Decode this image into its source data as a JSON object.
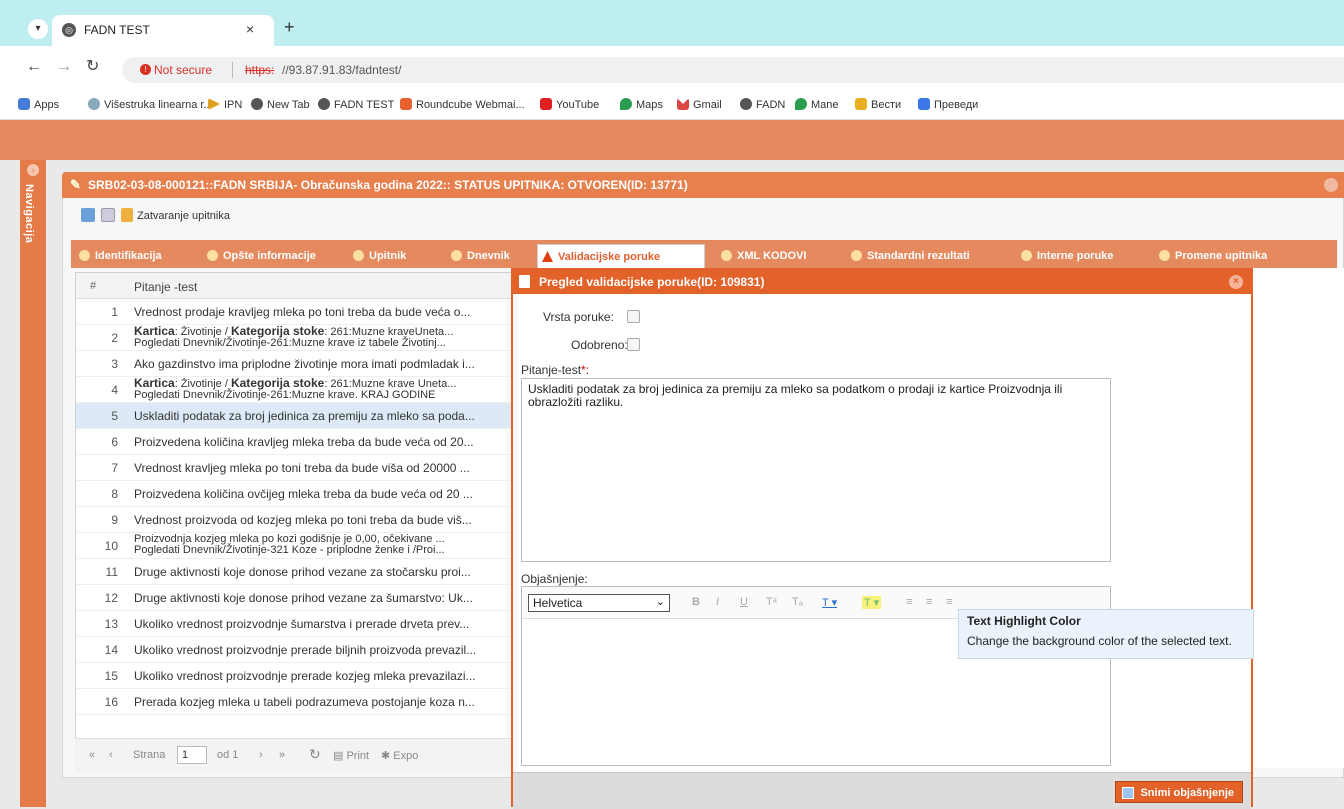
{
  "browser": {
    "tab_title": "FADN TEST",
    "tab_close": "×",
    "new_tab": "+",
    "not_secure": "Not secure",
    "url_scheme": "https:",
    "url_rest": "//93.87.91.83/fadntest/",
    "bookmarks": [
      "Apps",
      "Višestruka linearna r...",
      "IPN",
      "New Tab",
      "FADN TEST",
      "Roundcube Webmai...",
      "YouTube",
      "Maps",
      "Gmail",
      "FADN",
      "Mane",
      "Вести",
      "Преведи"
    ]
  },
  "nav": {
    "label": "Navigacija"
  },
  "window": {
    "title": "SRB02-03-08-000121::FADN SRBIJA- Obračunska godina 2022:: STATUS UPITNIKA: OTVOREN(ID: 13771)",
    "toolbar_label": "Zatvaranje upitnika"
  },
  "tabs": [
    "Identifikacija",
    "Opšte informacije",
    "Upitnik",
    "Dnevnik",
    "Validacijske poruke",
    "XML KODOVI",
    "Standardni rezultati",
    "Interne poruke",
    "Promene upitnika"
  ],
  "grid": {
    "num_header": "#",
    "col_header": "Pitanje -test",
    "rows": [
      {
        "n": "1",
        "text": "Vrednost prodaje kravljeg mleka po toni treba da bude veća o..."
      },
      {
        "n": "2",
        "b1": "Kartica",
        "t1": ": Životinje / ",
        "b2": "Kategorija stoke",
        "t2": ": 261:Muzne kraveUneta...",
        "l2": "Pogledati Dnevnik/Životinje-261:Muzne krave iz tabele Životinj..."
      },
      {
        "n": "3",
        "text": "Ako gazdinstvo ima priplodne životinje mora imati podmladak i..."
      },
      {
        "n": "4",
        "b1": "Kartica",
        "t1": ": Životinje / ",
        "b2": "Kategorija stoke",
        "t2": ": 261:Muzne krave Uneta...",
        "l2": "Pogledati Dnevnik/Životinje-261:Muzne krave. KRAJ GODINE"
      },
      {
        "n": "5",
        "text": "Uskladiti podatak za broj jedinica za premiju za mleko sa poda..."
      },
      {
        "n": "6",
        "text": "Proizvedena količina kravljeg mleka treba da bude veća od 20..."
      },
      {
        "n": "7",
        "text": "Vrednost kravljeg mleka po toni treba da bude viša od 20000 ..."
      },
      {
        "n": "8",
        "text": "Proizvedena količina ovčijeg mleka treba da bude veća od 20 ..."
      },
      {
        "n": "9",
        "text": "Vrednost proizvoda od kozjeg mleka po toni treba da bude viš..."
      },
      {
        "n": "10",
        "text": "Proizvodnja kozjeg mleka po kozi godišnje je 0,00, očekivane ...",
        "l2": "Pogledati Dnevnik/Životinje-321 Koze - priplodne ženke i /Proi..."
      },
      {
        "n": "11",
        "text": "Druge aktivnosti koje donose prihod vezane za stočarsku proi..."
      },
      {
        "n": "12",
        "text": "Druge aktivnosti koje donose prihod vezane za šumarstvo: Uk..."
      },
      {
        "n": "13",
        "text": "Ukoliko vrednost proizvodnje šumarstva i prerade drveta prev..."
      },
      {
        "n": "14",
        "text": "Ukoliko vrednost proizvodnje prerade biljnih proizvoda prevazil..."
      },
      {
        "n": "15",
        "text": "Ukoliko vrednost proizvodnje prerade kozjeg mleka prevazilazi..."
      },
      {
        "n": "16",
        "text": "Prerada kozjeg mleka u tabeli podrazumeva postojanje koza n..."
      }
    ],
    "selected_index": 4
  },
  "pager": {
    "page_label": "Strana",
    "page_value": "1",
    "of_label": "od 1",
    "print_label": "Print",
    "export_label": "Expo"
  },
  "modal": {
    "title": "Pregled validacijske poruke(ID: 109831)",
    "close": "×",
    "vrsta_label": "Vrsta poruke:",
    "odobreno_label": "Odobreno:",
    "question_label": "Pitanje-test",
    "required_mark": "*:",
    "question_text": "Uskladiti podatak za broj jedinica za premiju za mleko sa podatkom o prodaji iz kartice Proizvodnja ili obrazložiti razliku.",
    "explanation_label": "Objašnjenje:",
    "font_value": "Helvetica",
    "save_label": "Snimi objašnjenje"
  },
  "editor_buttons": {
    "bold": "B",
    "italic": "I",
    "underline": "U",
    "superscript": "Tᵃ",
    "subscript": "Tₐ",
    "text_color": "T ▾",
    "highlight": "T ▾",
    "align_left": "≡",
    "align_center": "≡",
    "align_right": "≡"
  },
  "tooltip": {
    "title": "Text Highlight Color",
    "body": "Change the background color of the selected text."
  },
  "colors": {
    "accent": "#e2622a",
    "tab_bar": "#e58a5f",
    "browser_tabstrip": "#bfeef0"
  }
}
